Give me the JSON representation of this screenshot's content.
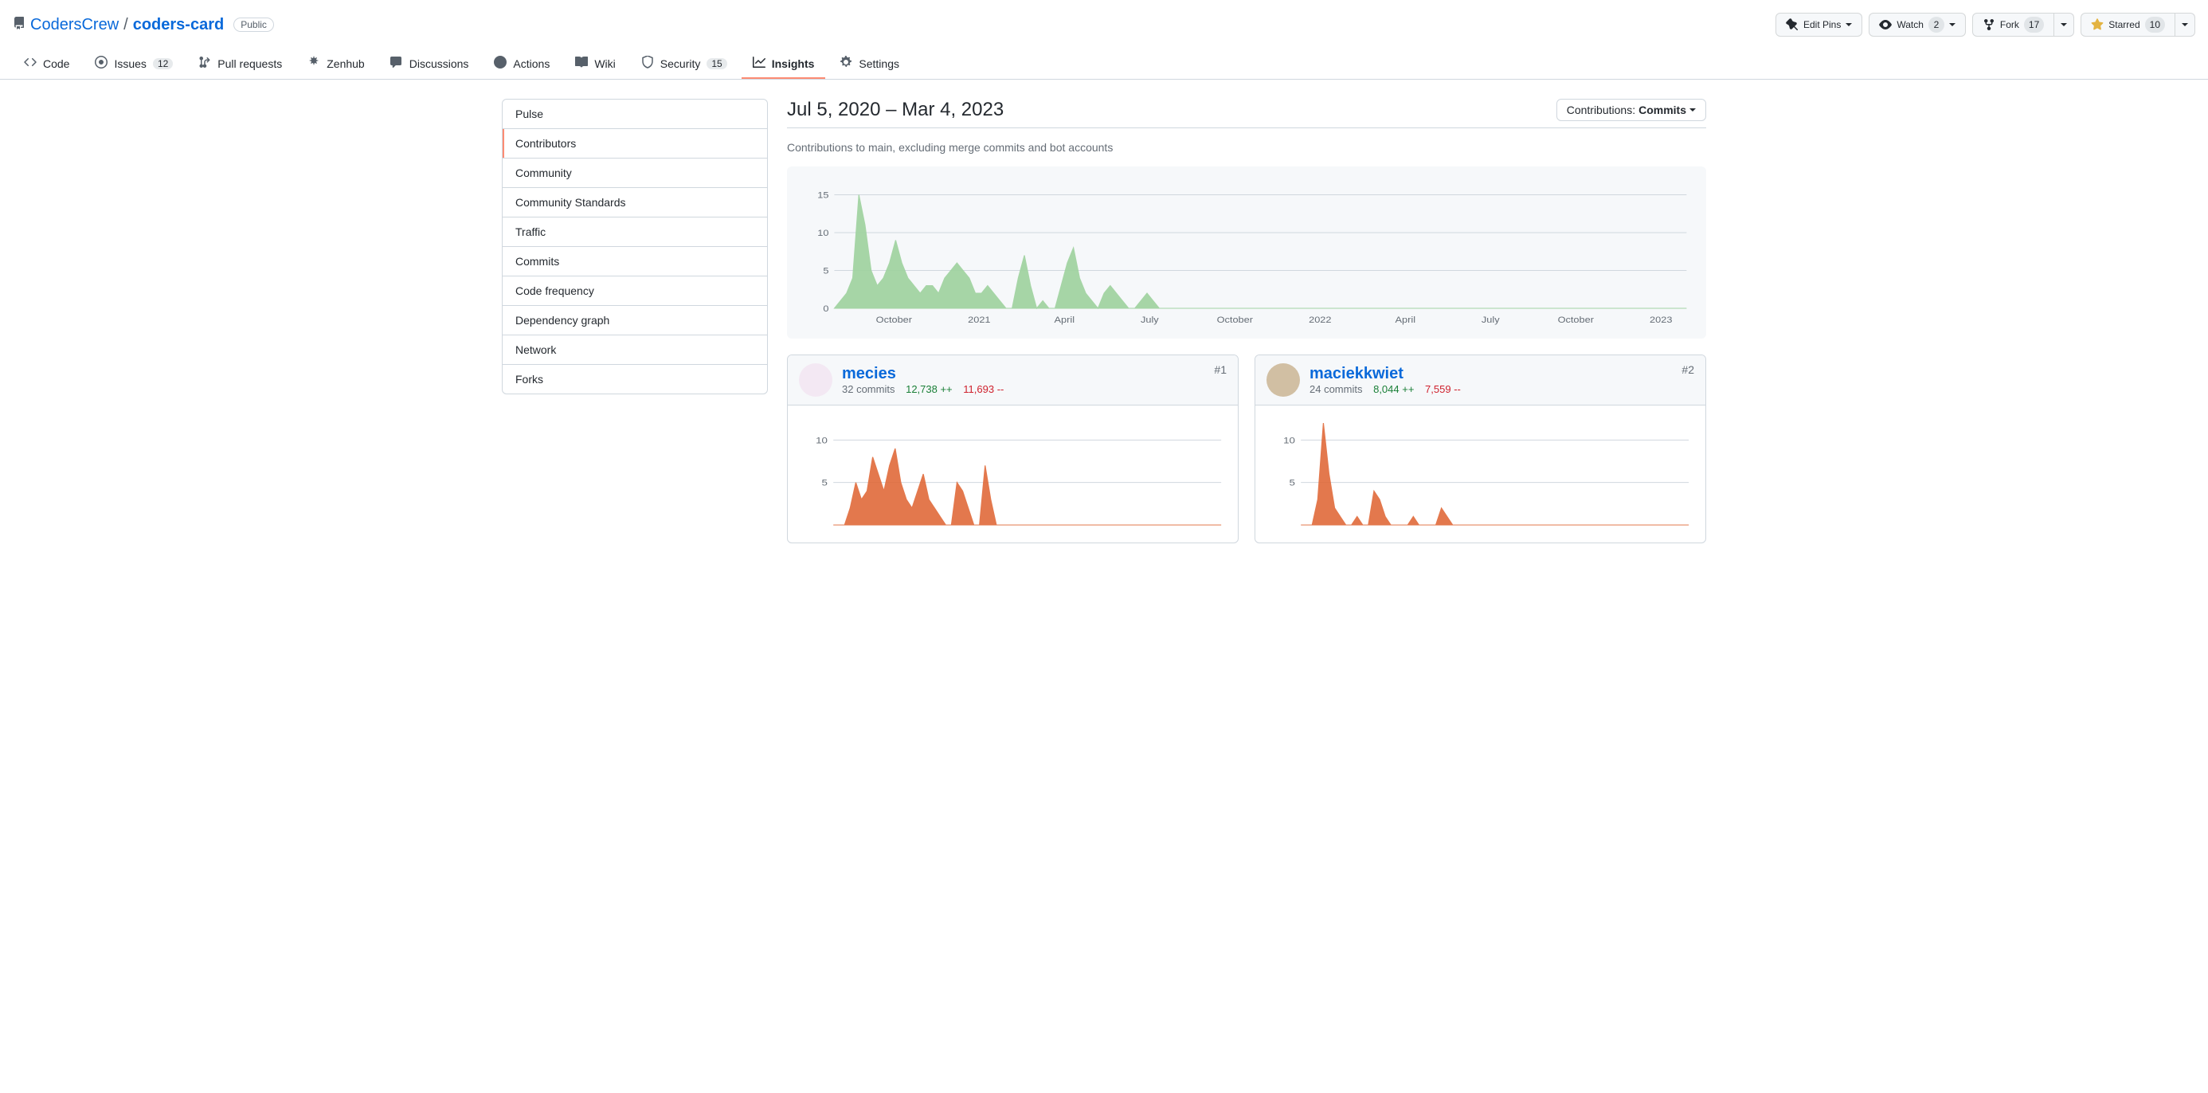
{
  "repo": {
    "owner": "CodersCrew",
    "name": "coders-card",
    "visibility": "Public"
  },
  "header_actions": {
    "edit_pins": "Edit Pins",
    "watch": "Watch",
    "watch_count": "2",
    "fork": "Fork",
    "fork_count": "17",
    "starred": "Starred",
    "star_count": "10"
  },
  "nav": {
    "code": "Code",
    "issues": "Issues",
    "issues_count": "12",
    "pulls": "Pull requests",
    "zenhub": "Zenhub",
    "discussions": "Discussions",
    "actions": "Actions",
    "wiki": "Wiki",
    "security": "Security",
    "security_count": "15",
    "insights": "Insights",
    "settings": "Settings"
  },
  "sidebar_items": [
    "Pulse",
    "Contributors",
    "Community",
    "Community Standards",
    "Traffic",
    "Commits",
    "Code frequency",
    "Dependency graph",
    "Network",
    "Forks"
  ],
  "page": {
    "title": "Jul 5, 2020 – Mar 4, 2023",
    "contrib_label": "Contributions: ",
    "contrib_type": "Commits",
    "subtitle": "Contributions to main, excluding merge commits and bot accounts"
  },
  "chart_data": {
    "type": "area",
    "ylabel": "",
    "xlabel": "",
    "ylim": [
      0,
      16
    ],
    "yticks": [
      0,
      5,
      10,
      15
    ],
    "xticks": [
      "October",
      "2021",
      "April",
      "July",
      "October",
      "2022",
      "April",
      "July",
      "October",
      "2023"
    ],
    "series": [
      {
        "name": "commits",
        "color": "#9ed29e",
        "values": [
          0,
          1,
          2,
          4,
          15,
          11,
          5,
          3,
          4,
          6,
          9,
          6,
          4,
          3,
          2,
          3,
          3,
          2,
          4,
          5,
          6,
          5,
          4,
          2,
          2,
          3,
          2,
          1,
          0,
          0,
          4,
          7,
          3,
          0,
          1,
          0,
          0,
          3,
          6,
          8,
          4,
          2,
          1,
          0,
          2,
          3,
          2,
          1,
          0,
          0,
          1,
          2,
          1,
          0,
          0,
          0,
          0,
          0,
          0,
          0,
          0,
          0,
          0,
          0,
          0,
          0,
          0,
          0,
          0,
          0,
          0,
          0,
          0,
          0,
          0,
          0,
          0,
          0,
          0,
          0,
          0,
          0,
          0,
          0,
          0,
          0,
          0,
          0,
          0,
          0,
          0,
          0,
          0,
          0,
          0,
          0,
          0,
          0,
          0,
          0,
          0,
          0,
          0,
          0,
          0,
          0,
          0,
          0,
          0,
          0,
          0,
          0,
          0,
          0,
          0,
          0,
          0,
          0,
          0,
          0,
          0,
          0,
          0,
          0,
          0,
          0,
          0,
          0,
          0,
          0,
          0,
          0,
          0,
          0,
          0,
          0,
          0,
          0,
          0,
          0
        ]
      }
    ]
  },
  "contributors": [
    {
      "username": "mecies",
      "rank": "#1",
      "commits": "32 commits",
      "additions": "12,738 ++",
      "deletions": "11,693 --",
      "avatar_bg": "#f3e8f3",
      "chart": {
        "type": "area",
        "ylim": [
          0,
          12
        ],
        "yticks": [
          5,
          10
        ],
        "color": "#e06a3a",
        "values": [
          0,
          0,
          0,
          2,
          5,
          3,
          4,
          8,
          6,
          4,
          7,
          9,
          5,
          3,
          2,
          4,
          6,
          3,
          2,
          1,
          0,
          0,
          5,
          4,
          2,
          0,
          0,
          7,
          3,
          0,
          0,
          0,
          0,
          0,
          0,
          0,
          0,
          0,
          0,
          0,
          0,
          0,
          0,
          0,
          0,
          0,
          0,
          0,
          0,
          0,
          0,
          0,
          0,
          0,
          0,
          0,
          0,
          0,
          0,
          0,
          0,
          0,
          0,
          0,
          0,
          0,
          0,
          0,
          0,
          0
        ]
      }
    },
    {
      "username": "maciekkwiet",
      "rank": "#2",
      "commits": "24 commits",
      "additions": "8,044 ++",
      "deletions": "7,559 --",
      "avatar_bg": "#d1bfa3",
      "chart": {
        "type": "area",
        "ylim": [
          0,
          12
        ],
        "yticks": [
          5,
          10
        ],
        "color": "#e06a3a",
        "values": [
          0,
          0,
          0,
          3,
          12,
          6,
          2,
          1,
          0,
          0,
          1,
          0,
          0,
          4,
          3,
          1,
          0,
          0,
          0,
          0,
          1,
          0,
          0,
          0,
          0,
          2,
          1,
          0,
          0,
          0,
          0,
          0,
          0,
          0,
          0,
          0,
          0,
          0,
          0,
          0,
          0,
          0,
          0,
          0,
          0,
          0,
          0,
          0,
          0,
          0,
          0,
          0,
          0,
          0,
          0,
          0,
          0,
          0,
          0,
          0,
          0,
          0,
          0,
          0,
          0,
          0,
          0,
          0,
          0,
          0
        ]
      }
    }
  ]
}
